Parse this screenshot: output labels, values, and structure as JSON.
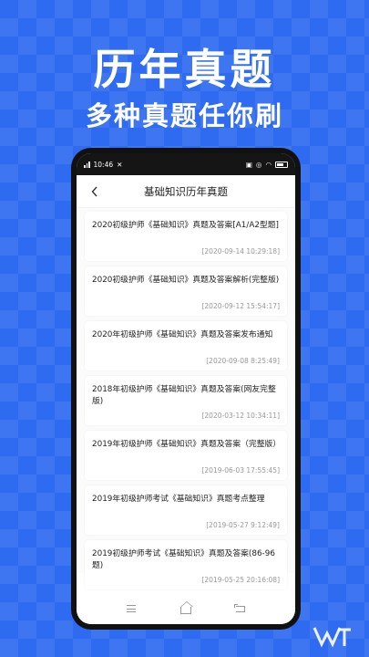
{
  "promo": {
    "title": "历年真题",
    "subtitle": "多种真题任你刷"
  },
  "status_bar": {
    "time": "10:46",
    "battery_color": "#ffffff"
  },
  "header": {
    "back_icon": "chevron-left-icon",
    "title": "基础知识历年真题"
  },
  "articles": [
    {
      "title": "2020初级护师《基础知识》真题及答案[A1/A2型题]",
      "date": "[2020-09-14 10:29:18]"
    },
    {
      "title": "2020初级护师《基础知识》真题及答案解析(完整版)",
      "date": "[2020-09-12 15:54:17]"
    },
    {
      "title": "2020年初级护师《基础知识》真题及答案发布通知",
      "date": "[2020-09-08 8:25:49]"
    },
    {
      "title": "2018年初级护师《基础知识》真题及答案(网友完整版)",
      "date": "[2020-03-12 10:34:11]"
    },
    {
      "title": "2019年初级护师《基础知识》真题及答案（完整版）",
      "date": "[2019-06-03 17:55:45]"
    },
    {
      "title": "2019年初级护师考试《基础知识》真题考点整理",
      "date": "[2019-05-27 9:12:49]"
    },
    {
      "title": "2019初级护师考试《基础知识》真题及答案(86-96题)",
      "date": "[2019-05-25 20:16:08]"
    }
  ],
  "nav_bar": {
    "icons": [
      "menu-icon",
      "home-icon",
      "back-icon"
    ]
  },
  "colors": {
    "background": "#2f6bf0",
    "card": "#ffffff",
    "date_text": "#999999"
  }
}
